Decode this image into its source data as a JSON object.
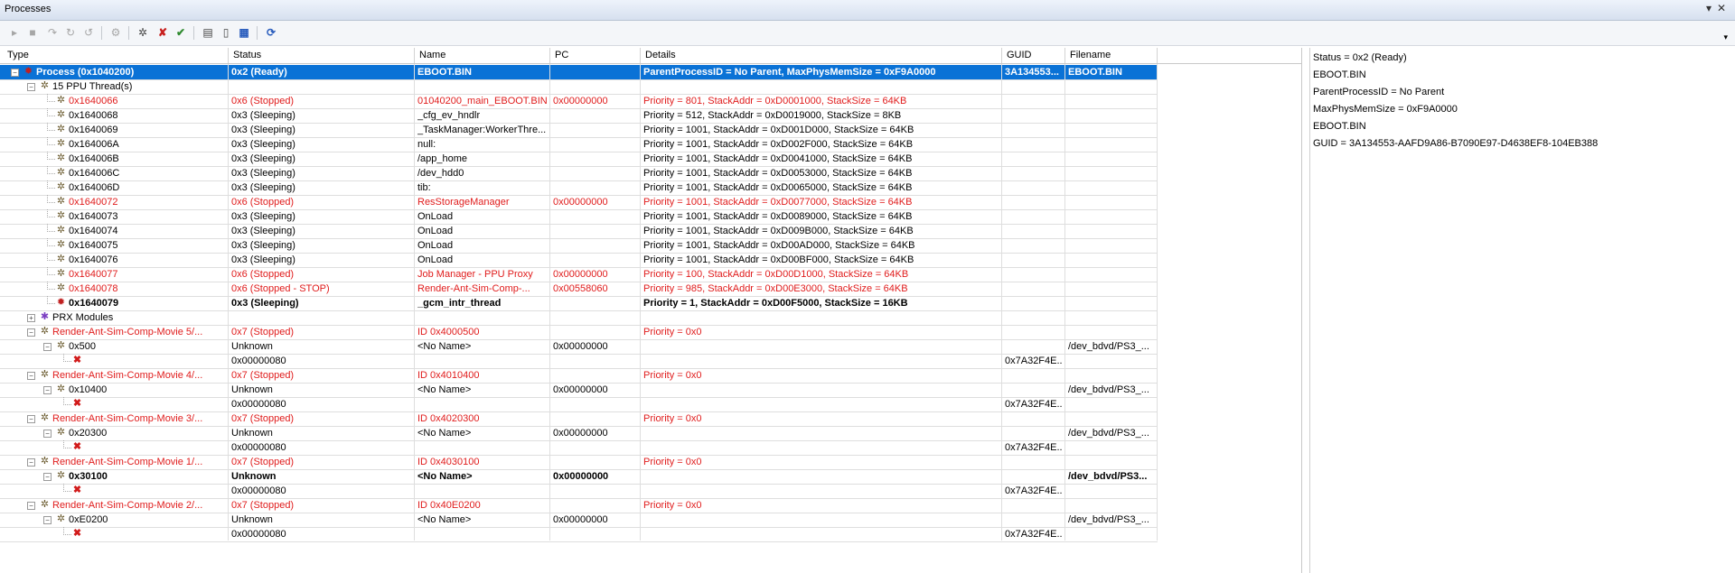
{
  "window": {
    "title": "Processes"
  },
  "columns": [
    "Type",
    "Status",
    "Name",
    "PC",
    "Details",
    "GUID",
    "Filename"
  ],
  "rows": [
    {
      "type": "Process (0x1040200)",
      "status": "0x2 (Ready)",
      "name": "EBOOT.BIN",
      "pc": "",
      "details": "ParentProcessID = No Parent, MaxPhysMemSize = 0xF9A0000",
      "guid": "3A134553...",
      "file": "EBOOT.BIN"
    },
    {
      "type": "15 PPU Thread(s)",
      "status": "",
      "name": "",
      "pc": "",
      "details": "",
      "guid": "",
      "file": ""
    },
    {
      "type": "0x1640066",
      "status": "0x6 (Stopped)",
      "name": "01040200_main_EBOOT.BIN",
      "pc": "0x00000000",
      "details": "Priority = 801, StackAddr = 0xD0001000, StackSize = 64KB",
      "guid": "",
      "file": ""
    },
    {
      "type": "0x1640068",
      "status": "0x3 (Sleeping)",
      "name": "_cfg_ev_hndlr",
      "pc": "",
      "details": "Priority = 512, StackAddr = 0xD0019000, StackSize = 8KB",
      "guid": "",
      "file": ""
    },
    {
      "type": "0x1640069",
      "status": "0x3 (Sleeping)",
      "name": "_TaskManager:WorkerThre...",
      "pc": "",
      "details": "Priority = 1001, StackAddr = 0xD001D000, StackSize = 64KB",
      "guid": "",
      "file": ""
    },
    {
      "type": "0x164006A",
      "status": "0x3 (Sleeping)",
      "name": "null:",
      "pc": "",
      "details": "Priority = 1001, StackAddr = 0xD002F000, StackSize = 64KB",
      "guid": "",
      "file": ""
    },
    {
      "type": "0x164006B",
      "status": "0x3 (Sleeping)",
      "name": "/app_home",
      "pc": "",
      "details": "Priority = 1001, StackAddr = 0xD0041000, StackSize = 64KB",
      "guid": "",
      "file": ""
    },
    {
      "type": "0x164006C",
      "status": "0x3 (Sleeping)",
      "name": "/dev_hdd0",
      "pc": "",
      "details": "Priority = 1001, StackAddr = 0xD0053000, StackSize = 64KB",
      "guid": "",
      "file": ""
    },
    {
      "type": "0x164006D",
      "status": "0x3 (Sleeping)",
      "name": "tib:",
      "pc": "",
      "details": "Priority = 1001, StackAddr = 0xD0065000, StackSize = 64KB",
      "guid": "",
      "file": ""
    },
    {
      "type": "0x1640072",
      "status": "0x6 (Stopped)",
      "name": "ResStorageManager",
      "pc": "0x00000000",
      "details": "Priority = 1001, StackAddr = 0xD0077000, StackSize = 64KB",
      "guid": "",
      "file": ""
    },
    {
      "type": "0x1640073",
      "status": "0x3 (Sleeping)",
      "name": "OnLoad",
      "pc": "",
      "details": "Priority = 1001, StackAddr = 0xD0089000, StackSize = 64KB",
      "guid": "",
      "file": ""
    },
    {
      "type": "0x1640074",
      "status": "0x3 (Sleeping)",
      "name": "OnLoad",
      "pc": "",
      "details": "Priority = 1001, StackAddr = 0xD009B000, StackSize = 64KB",
      "guid": "",
      "file": ""
    },
    {
      "type": "0x1640075",
      "status": "0x3 (Sleeping)",
      "name": "OnLoad",
      "pc": "",
      "details": "Priority = 1001, StackAddr = 0xD00AD000, StackSize = 64KB",
      "guid": "",
      "file": ""
    },
    {
      "type": "0x1640076",
      "status": "0x3 (Sleeping)",
      "name": "OnLoad",
      "pc": "",
      "details": "Priority = 1001, StackAddr = 0xD00BF000, StackSize = 64KB",
      "guid": "",
      "file": ""
    },
    {
      "type": "0x1640077",
      "status": "0x6 (Stopped)",
      "name": "Job Manager - PPU Proxy",
      "pc": "0x00000000",
      "details": "Priority = 100, StackAddr = 0xD00D1000, StackSize = 64KB",
      "guid": "",
      "file": ""
    },
    {
      "type": "0x1640078",
      "status": "0x6 (Stopped - STOP)",
      "name": "Render-Ant-Sim-Comp-...",
      "pc": "0x00558060",
      "details": "Priority = 985, StackAddr = 0xD00E3000, StackSize = 64KB",
      "guid": "",
      "file": ""
    },
    {
      "type": "0x1640079",
      "status": "0x3 (Sleeping)",
      "name": "_gcm_intr_thread",
      "pc": "",
      "details": "Priority = 1, StackAddr = 0xD00F5000, StackSize = 16KB",
      "guid": "",
      "file": ""
    },
    {
      "type": "PRX Modules",
      "status": "",
      "name": "",
      "pc": "",
      "details": "",
      "guid": "",
      "file": ""
    },
    {
      "type": "Render-Ant-Sim-Comp-Movie 5/...",
      "status": "0x7 (Stopped)",
      "name": "ID 0x4000500",
      "pc": "",
      "details": "Priority = 0x0",
      "guid": "",
      "file": ""
    },
    {
      "type": "0x500",
      "status": "Unknown",
      "name": "<No Name>",
      "pc": "0x00000000",
      "details": "",
      "guid": "",
      "file": "/dev_bdvd/PS3_..."
    },
    {
      "type": "",
      "status": "0x00000080",
      "name": "",
      "pc": "",
      "details": "",
      "guid": "0x7A32F4E...",
      "file": ""
    },
    {
      "type": "Render-Ant-Sim-Comp-Movie 4/...",
      "status": "0x7 (Stopped)",
      "name": "ID 0x4010400",
      "pc": "",
      "details": "Priority = 0x0",
      "guid": "",
      "file": ""
    },
    {
      "type": "0x10400",
      "status": "Unknown",
      "name": "<No Name>",
      "pc": "0x00000000",
      "details": "",
      "guid": "",
      "file": "/dev_bdvd/PS3_..."
    },
    {
      "type": "",
      "status": "0x00000080",
      "name": "",
      "pc": "",
      "details": "",
      "guid": "0x7A32F4E...",
      "file": ""
    },
    {
      "type": "Render-Ant-Sim-Comp-Movie 3/...",
      "status": "0x7 (Stopped)",
      "name": "ID 0x4020300",
      "pc": "",
      "details": "Priority = 0x0",
      "guid": "",
      "file": ""
    },
    {
      "type": "0x20300",
      "status": "Unknown",
      "name": "<No Name>",
      "pc": "0x00000000",
      "details": "",
      "guid": "",
      "file": "/dev_bdvd/PS3_..."
    },
    {
      "type": "",
      "status": "0x00000080",
      "name": "",
      "pc": "",
      "details": "",
      "guid": "0x7A32F4E...",
      "file": ""
    },
    {
      "type": "Render-Ant-Sim-Comp-Movie 1/...",
      "status": "0x7 (Stopped)",
      "name": "ID 0x4030100",
      "pc": "",
      "details": "Priority = 0x0",
      "guid": "",
      "file": ""
    },
    {
      "type": "0x30100",
      "status": "Unknown",
      "name": "<No Name>",
      "pc": "0x00000000",
      "details": "",
      "guid": "",
      "file": "/dev_bdvd/PS3..."
    },
    {
      "type": "",
      "status": "0x00000080",
      "name": "",
      "pc": "",
      "details": "",
      "guid": "0x7A32F4E...",
      "file": ""
    },
    {
      "type": "Render-Ant-Sim-Comp-Movie 2/...",
      "status": "0x7 (Stopped)",
      "name": "ID 0x40E0200",
      "pc": "",
      "details": "Priority = 0x0",
      "guid": "",
      "file": ""
    },
    {
      "type": "0xE0200",
      "status": "Unknown",
      "name": "<No Name>",
      "pc": "0x00000000",
      "details": "",
      "guid": "",
      "file": "/dev_bdvd/PS3_..."
    },
    {
      "type": "",
      "status": "0x00000080",
      "name": "",
      "pc": "",
      "details": "",
      "guid": "0x7A32F4E...",
      "file": ""
    }
  ],
  "detail_panel": {
    "lines": [
      "Status = 0x2 (Ready)",
      "EBOOT.BIN",
      "ParentProcessID = No Parent",
      "MaxPhysMemSize = 0xF9A0000",
      "EBOOT.BIN",
      "GUID = 3A134553-AAFD9A86-B7090E97-D4638EF8-104EB388"
    ]
  }
}
